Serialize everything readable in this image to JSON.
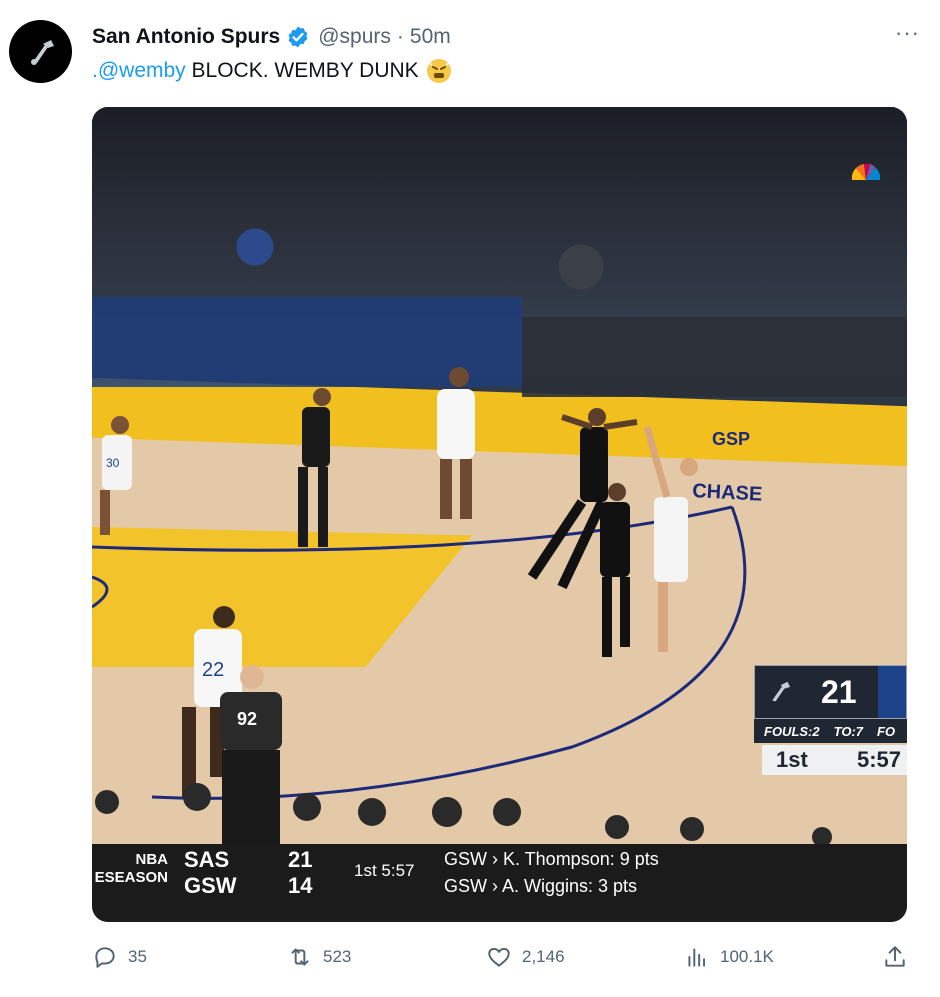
{
  "author": {
    "name": "San Antonio Spurs",
    "handle": "@spurs",
    "separator": "·",
    "time": "50m"
  },
  "more_label": "···",
  "tweet": {
    "mention": ".@wemby",
    "text": " BLOCK. WEMBY DUNK"
  },
  "broadcast": {
    "score_bug": {
      "score": "21",
      "fouls": "FOULS:2",
      "timeouts": "TO:7",
      "opp_fouls_partial": "FO",
      "period": "1st",
      "clock": "5:57"
    },
    "ticker": {
      "league_line1": "NBA",
      "league_line2": "ESEASON",
      "team1": "SAS",
      "team2": "GSW",
      "score1": "21",
      "score2": "14",
      "clock": "1st 5:57",
      "stat1": "GSW › K. Thompson: 9 pts",
      "stat2": "GSW › A. Wiggins: 3 pts"
    },
    "jerseys": {
      "p1": "30",
      "p2": "22",
      "ref": "92"
    },
    "court_text": {
      "chase": "CHASE",
      "gsw": "GSP"
    }
  },
  "actions": {
    "replies": "35",
    "reposts": "523",
    "likes": "2,146",
    "views": "100.1K"
  },
  "colors": {
    "link": "#1d9bf0",
    "muted": "#536471",
    "verified": "#1d9bf0"
  }
}
